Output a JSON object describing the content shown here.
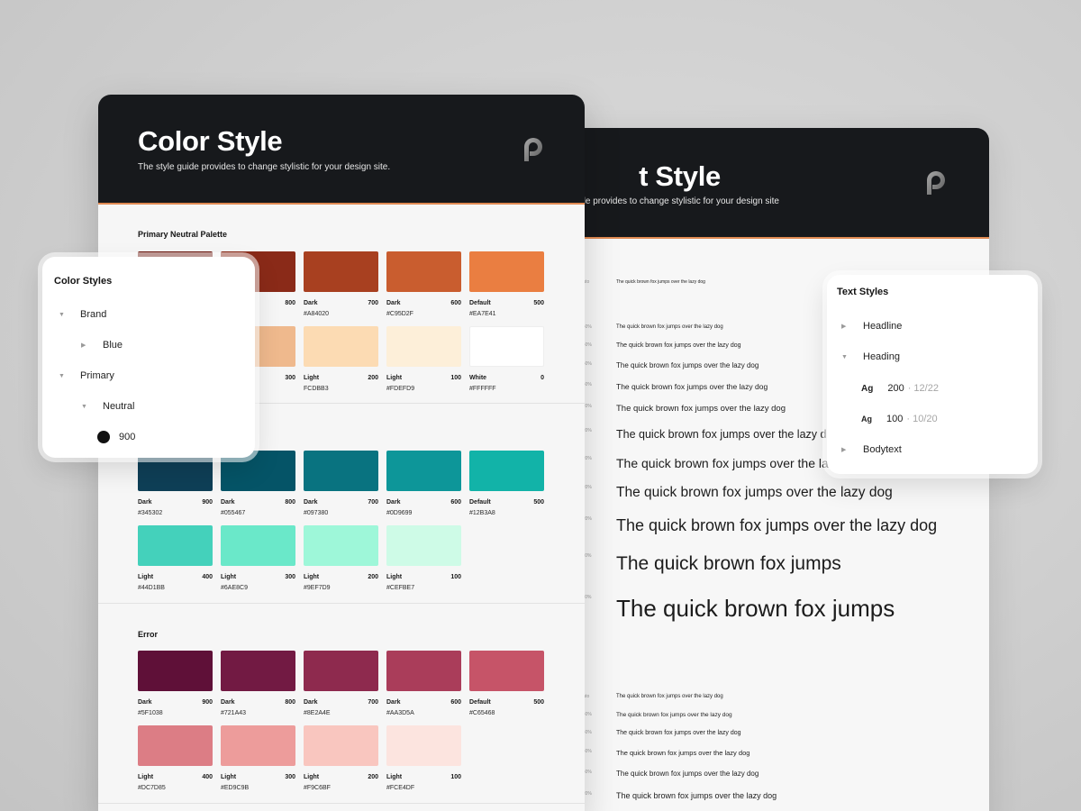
{
  "colorSheet": {
    "title": "Color Style",
    "subtitle": "The style guide provides to change stylistic for your design site.",
    "sections": [
      {
        "title": "Primary Neutral Palette",
        "rows": [
          [
            {
              "name": "",
              "num": "",
              "hex": "",
              "color": "#6e1a12"
            },
            {
              "name": "",
              "num": "800",
              "hex": "",
              "color": "#8a2a18"
            },
            {
              "name": "Dark",
              "num": "700",
              "hex": "#A84020",
              "color": "#a84020"
            },
            {
              "name": "Dark",
              "num": "600",
              "hex": "#C95D2F",
              "color": "#c95d2f"
            },
            {
              "name": "Default",
              "num": "500",
              "hex": "#EA7E41",
              "color": "#ea7e41"
            }
          ],
          [
            {
              "name": "",
              "num": "",
              "hex": "",
              "color": "#f1c39a"
            },
            {
              "name": "",
              "num": "300",
              "hex": "",
              "color": "#efb98d"
            },
            {
              "name": "Light",
              "num": "200",
              "hex": "FCDBB3",
              "color": "#fcdbb3"
            },
            {
              "name": "Light",
              "num": "100",
              "hex": "#FDEFD9",
              "color": "#fdefd9"
            },
            {
              "name": "White",
              "num": "0",
              "hex": "#FFFFFF",
              "color": "#ffffff"
            }
          ]
        ]
      },
      {
        "title": "",
        "rows": [
          [
            {
              "name": "Dark",
              "num": "900",
              "hex": "#345302",
              "color": "#0e3f57"
            },
            {
              "name": "Dark",
              "num": "800",
              "hex": "#055467",
              "color": "#055467"
            },
            {
              "name": "Dark",
              "num": "700",
              "hex": "#097380",
              "color": "#097380"
            },
            {
              "name": "Dark",
              "num": "600",
              "hex": "#0D9699",
              "color": "#0d9699"
            },
            {
              "name": "Default",
              "num": "500",
              "hex": "#12B3A8",
              "color": "#12b3a8"
            }
          ],
          [
            {
              "name": "Light",
              "num": "400",
              "hex": "#44D1BB",
              "color": "#44d1bb"
            },
            {
              "name": "Light",
              "num": "300",
              "hex": "#6AE8C9",
              "color": "#6ae8c9"
            },
            {
              "name": "Light",
              "num": "200",
              "hex": "#9EF7D9",
              "color": "#9ef7d9"
            },
            {
              "name": "Light",
              "num": "100",
              "hex": "#CEFBE7",
              "color": "#cefbe7"
            }
          ]
        ]
      },
      {
        "title": "Error",
        "rows": [
          [
            {
              "name": "Dark",
              "num": "900",
              "hex": "#5F1038",
              "color": "#5f1038"
            },
            {
              "name": "Dark",
              "num": "800",
              "hex": "#721A43",
              "color": "#721a43"
            },
            {
              "name": "Dark",
              "num": "700",
              "hex": "#8E2A4E",
              "color": "#8e2a4e"
            },
            {
              "name": "Dark",
              "num": "600",
              "hex": "#AA3D5A",
              "color": "#aa3d5a"
            },
            {
              "name": "Default",
              "num": "500",
              "hex": "#C65468",
              "color": "#c65468"
            }
          ],
          [
            {
              "name": "Light",
              "num": "400",
              "hex": "#DC7D85",
              "color": "#dc7d85"
            },
            {
              "name": "Light",
              "num": "300",
              "hex": "#ED9C9B",
              "color": "#ed9c9b"
            },
            {
              "name": "Light",
              "num": "200",
              "hex": "#F9C6BF",
              "color": "#f9c6bf"
            },
            {
              "name": "Light",
              "num": "100",
              "hex": "#FCE4DF",
              "color": "#fce4df"
            }
          ]
        ]
      }
    ]
  },
  "textSheet": {
    "title": "t Style",
    "subtitle": "de provides to change stylistic for your design site.",
    "sectionFragment": "n",
    "rows": [
      {
        "lh": "Auto",
        "text": "The quick brown fox jumps over the lazy dog"
      },
      {
        "lh": "140%",
        "text": "The quick brown fox jumps over the lazy dog"
      },
      {
        "lh": "140%",
        "text": "The quick brown fox jumps over the lazy dog"
      },
      {
        "lh": "140%",
        "text": "The quick brown fox jumps over the lazy dog"
      },
      {
        "lh": "140%",
        "text": "The quick brown fox jumps over the lazy dog"
      },
      {
        "lh": "120%",
        "text": "The quick brown fox jumps over the lazy dog"
      },
      {
        "lh": "120%",
        "text": "The quick brown fox jumps over the lazy dog"
      },
      {
        "lh": "120%",
        "text": "The quick brown fox jumps over the lazy dog"
      },
      {
        "lh": "120%",
        "text": "The quick brown fox jumps over the lazy dog"
      },
      {
        "lh": "120%",
        "text": "The quick brown fox jumps over the lazy dog"
      },
      {
        "lh": "110%",
        "text": "The quick brown fox jumps"
      },
      {
        "lh": "110%",
        "text": "The quick brown fox jumps"
      }
    ],
    "rows2": [
      {
        "lh": "Auto",
        "text": "The quick brown fox jumps over the lazy dog"
      },
      {
        "lh": "140%",
        "text": "The quick brown fox jumps over the lazy dog"
      },
      {
        "lh": "140%",
        "text": "The quick brown fox jumps over the lazy dog"
      },
      {
        "lh": "140%",
        "text": "The quick brown fox jumps over the lazy dog"
      },
      {
        "lh": "140%",
        "text": "The quick brown fox jumps over the lazy dog"
      },
      {
        "lh": "120%",
        "text": "The quick brown fox jumps over the lazy dog"
      }
    ]
  },
  "colorPanel": {
    "title": "Color Styles",
    "items": {
      "brand": "Brand",
      "blue": "Blue",
      "primary": "Primary",
      "neutral": "Neutral",
      "n900": "900"
    }
  },
  "textPanel": {
    "title": "Text Styles",
    "items": {
      "headline": "Headline",
      "heading": "Heading",
      "h200": "200",
      "h200meta": "· 12/22",
      "h100": "100",
      "h100meta": "· 10/20",
      "bodytext": "Bodytext",
      "ag": "Ag"
    }
  }
}
